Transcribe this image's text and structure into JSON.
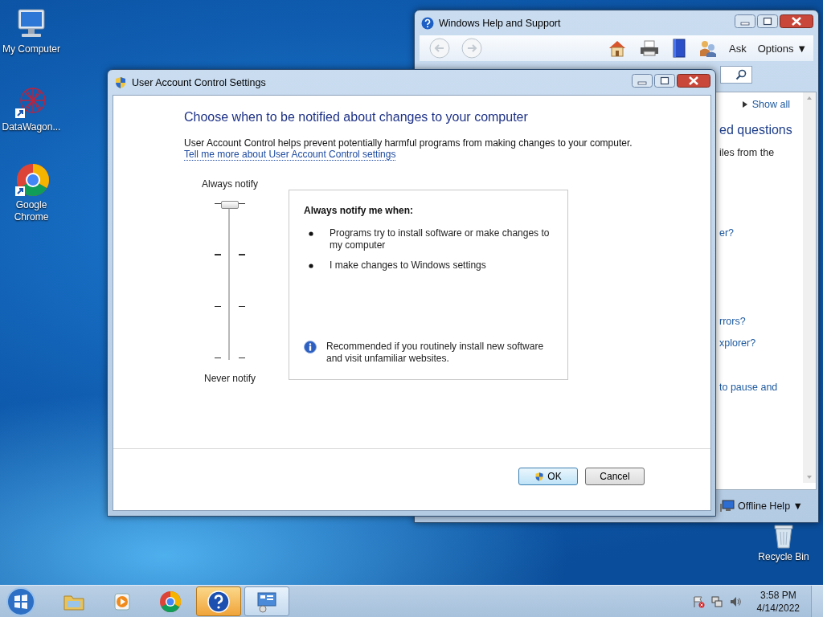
{
  "desktop_icons": [
    {
      "kind": "computer",
      "label": "My Computer"
    },
    {
      "kind": "shortcut",
      "label": "DataWagon..."
    },
    {
      "kind": "chrome",
      "label": "Google Chrome"
    }
  ],
  "recycle_bin": {
    "label": "Recycle Bin"
  },
  "help_window": {
    "title": "Windows Help and Support",
    "ask": "Ask",
    "options": "Options",
    "options_caret": "▼",
    "show_all": "Show all",
    "heading": "ed questions",
    "lines": [
      {
        "kind": "text",
        "text": "iles from the"
      },
      {
        "kind": "link",
        "text": "er?"
      },
      {
        "kind": "link",
        "text": "rrors?"
      },
      {
        "kind": "link",
        "text": "xplorer?"
      },
      {
        "kind": "link",
        "text": "to pause and"
      }
    ],
    "footer": "Offline Help",
    "footer_caret": "▼"
  },
  "uac_window": {
    "title": "User Account Control Settings",
    "heading": "Choose when to be notified about changes to your computer",
    "description": "User Account Control helps prevent potentially harmful programs from making changes to your computer.",
    "link": "Tell me more about User Account Control settings",
    "slider": {
      "top_label": "Always notify",
      "bottom_label": "Never notify",
      "level": 1
    },
    "notify_box": {
      "title": "Always notify me when:",
      "bullets": [
        "Programs try to install software or make changes to my computer",
        "I make changes to Windows settings"
      ],
      "recommendation": "Recommended if you routinely install new software and visit unfamiliar websites."
    },
    "buttons": [
      {
        "kind": "ok",
        "label": "OK"
      },
      {
        "kind": "cancel",
        "label": "Cancel"
      }
    ]
  },
  "taskbar": {
    "items": [
      {
        "kind": "explorer",
        "selected": false,
        "flashing": false
      },
      {
        "kind": "media",
        "selected": false,
        "flashing": false
      },
      {
        "kind": "chrome",
        "selected": false,
        "flashing": false
      },
      {
        "kind": "help",
        "selected": false,
        "flashing": true
      },
      {
        "kind": "uac",
        "selected": true,
        "flashing": false
      }
    ],
    "time": "3:58 PM",
    "date": "4/14/2022"
  }
}
